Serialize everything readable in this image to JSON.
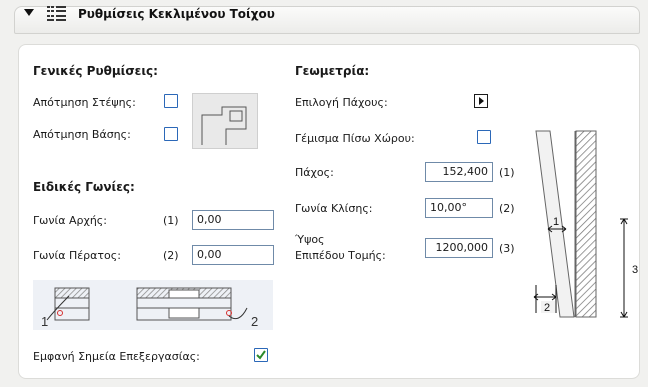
{
  "header": {
    "title": "Ρυθμίσεις Κεκλιμένου Τοίχου",
    "collapse_icon": "triangle-down-icon",
    "settings_icon": "grid-settings-icon"
  },
  "general": {
    "title": "Γενικές Ρυθμίσεις:",
    "roof_trim_label": "Απότμηση Στέψης:",
    "roof_trim_checked": false,
    "base_trim_label": "Απότμηση Βάσης:",
    "base_trim_checked": false,
    "preview_icon": "wall-trim-preview-icon"
  },
  "special_angles": {
    "title": "Ειδικές Γωνίες:",
    "start_label": "Γωνία Αρχής:",
    "start_index": "(1)",
    "start_value": "0,00",
    "end_label": "Γωνία Πέρατος:",
    "end_index": "(2)",
    "end_value": "0,00",
    "diagram_icon": "end-angle-diagram-icon",
    "diagram_label_1": "1",
    "diagram_label_2": "2"
  },
  "processing": {
    "label": "Εμφανή Σημεία Επεξεργασίας:",
    "checked": true,
    "accent": "#2b8a2b"
  },
  "geometry": {
    "title": "Γεωμετρία:",
    "thickness_choice_label": "Επιλογή Πάχους:",
    "fill_back_label": "Γέμισμα Πίσω Χώρου:",
    "fill_back_checked": false,
    "thickness_label": "Πάχος:",
    "thickness_value": "152,400",
    "thickness_index": "(1)",
    "slope_label": "Γωνία Κλίσης:",
    "slope_value": "10,00°",
    "slope_index": "(2)",
    "height_label_line1": "Ύψος",
    "height_label_line2": "Επιπέδου Τομής:",
    "height_value": "1200,000",
    "height_index": "(3)",
    "diagram_icon": "slanted-wall-diagram-icon",
    "diagram_label_1": "1",
    "diagram_label_2": "2",
    "diagram_label_3": "3"
  },
  "colors": {
    "input_border": "#6f8aa8",
    "checkbox_border": "#2b68b8",
    "panel_bg": "#ffffff"
  }
}
